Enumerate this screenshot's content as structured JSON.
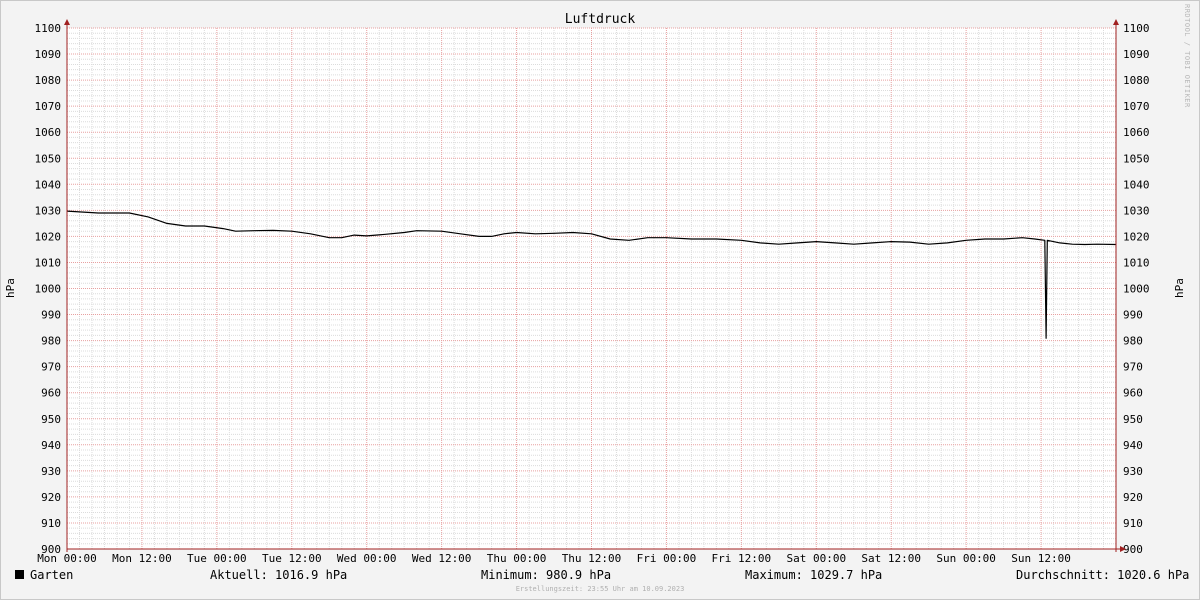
{
  "chart_data": {
    "type": "line",
    "title": "Luftdruck",
    "ylabel": "hPa",
    "ylabel_right": "hPa",
    "ylim": [
      900,
      1100
    ],
    "yticks": [
      900,
      910,
      920,
      930,
      940,
      950,
      960,
      970,
      980,
      990,
      1000,
      1010,
      1020,
      1030,
      1040,
      1050,
      1060,
      1070,
      1080,
      1090,
      1100
    ],
    "xlim_hours": [
      0,
      168
    ],
    "xticks": [
      {
        "h": 0,
        "label": "Mon 00:00"
      },
      {
        "h": 12,
        "label": "Mon 12:00"
      },
      {
        "h": 24,
        "label": "Tue 00:00"
      },
      {
        "h": 36,
        "label": "Tue 12:00"
      },
      {
        "h": 48,
        "label": "Wed 00:00"
      },
      {
        "h": 60,
        "label": "Wed 12:00"
      },
      {
        "h": 72,
        "label": "Thu 00:00"
      },
      {
        "h": 84,
        "label": "Thu 12:00"
      },
      {
        "h": 96,
        "label": "Fri 00:00"
      },
      {
        "h": 108,
        "label": "Fri 12:00"
      },
      {
        "h": 120,
        "label": "Sat 00:00"
      },
      {
        "h": 132,
        "label": "Sat 12:00"
      },
      {
        "h": 144,
        "label": "Sun 00:00"
      },
      {
        "h": 156,
        "label": "Sun 12:00"
      }
    ],
    "series": [
      {
        "name": "Garten",
        "color": "#000000",
        "points": [
          [
            0,
            1029.7
          ],
          [
            5,
            1029.0
          ],
          [
            10,
            1029.0
          ],
          [
            13,
            1027.5
          ],
          [
            16,
            1025.0
          ],
          [
            19,
            1024.0
          ],
          [
            22,
            1024.0
          ],
          [
            25,
            1023.0
          ],
          [
            27,
            1022.0
          ],
          [
            30,
            1022.2
          ],
          [
            33,
            1022.3
          ],
          [
            36,
            1022.0
          ],
          [
            39,
            1021.0
          ],
          [
            42,
            1019.5
          ],
          [
            44,
            1019.5
          ],
          [
            46,
            1020.5
          ],
          [
            48,
            1020.2
          ],
          [
            51,
            1020.8
          ],
          [
            54,
            1021.5
          ],
          [
            56,
            1022.2
          ],
          [
            60,
            1022.0
          ],
          [
            63,
            1021.0
          ],
          [
            66,
            1020.0
          ],
          [
            68,
            1020.0
          ],
          [
            70,
            1021.0
          ],
          [
            72,
            1021.5
          ],
          [
            75,
            1021.0
          ],
          [
            78,
            1021.2
          ],
          [
            81,
            1021.5
          ],
          [
            84,
            1021.0
          ],
          [
            87,
            1019.0
          ],
          [
            90,
            1018.5
          ],
          [
            93,
            1019.5
          ],
          [
            96,
            1019.5
          ],
          [
            100,
            1019.0
          ],
          [
            104,
            1019.0
          ],
          [
            108,
            1018.5
          ],
          [
            111,
            1017.5
          ],
          [
            114,
            1017.0
          ],
          [
            117,
            1017.5
          ],
          [
            120,
            1018.0
          ],
          [
            123,
            1017.5
          ],
          [
            126,
            1017.0
          ],
          [
            129,
            1017.5
          ],
          [
            132,
            1018.0
          ],
          [
            135,
            1017.8
          ],
          [
            138,
            1017.0
          ],
          [
            141,
            1017.5
          ],
          [
            144,
            1018.5
          ],
          [
            147,
            1019.0
          ],
          [
            150,
            1019.0
          ],
          [
            153,
            1019.5
          ],
          [
            155,
            1019.0
          ],
          [
            156.6,
            1018.5
          ],
          [
            156.8,
            980.9
          ],
          [
            157.0,
            1018.5
          ],
          [
            159,
            1017.5
          ],
          [
            161,
            1017.0
          ],
          [
            163,
            1016.9
          ],
          [
            165,
            1017.0
          ],
          [
            168,
            1016.9
          ]
        ]
      }
    ]
  },
  "legend": {
    "series_name": "Garten",
    "current": "Aktuell: 1016.9 hPa",
    "minimum": "Minimum: 980.9 hPa",
    "maximum": "Maximum: 1029.7 hPa",
    "average": "Durchschnitt: 1020.6 hPa"
  },
  "footer": "Erstellungszeit: 23:55 Uhr am 10.09.2023",
  "watermark": "RRDTOOL / TOBI OETIKER",
  "colors": {
    "background": "#f3f3f3",
    "plot_background": "#ffffff",
    "grid_minor": "#d9d9d9",
    "grid_major": "#e8a0a0",
    "axis": "#a02020",
    "line": "#000000"
  }
}
